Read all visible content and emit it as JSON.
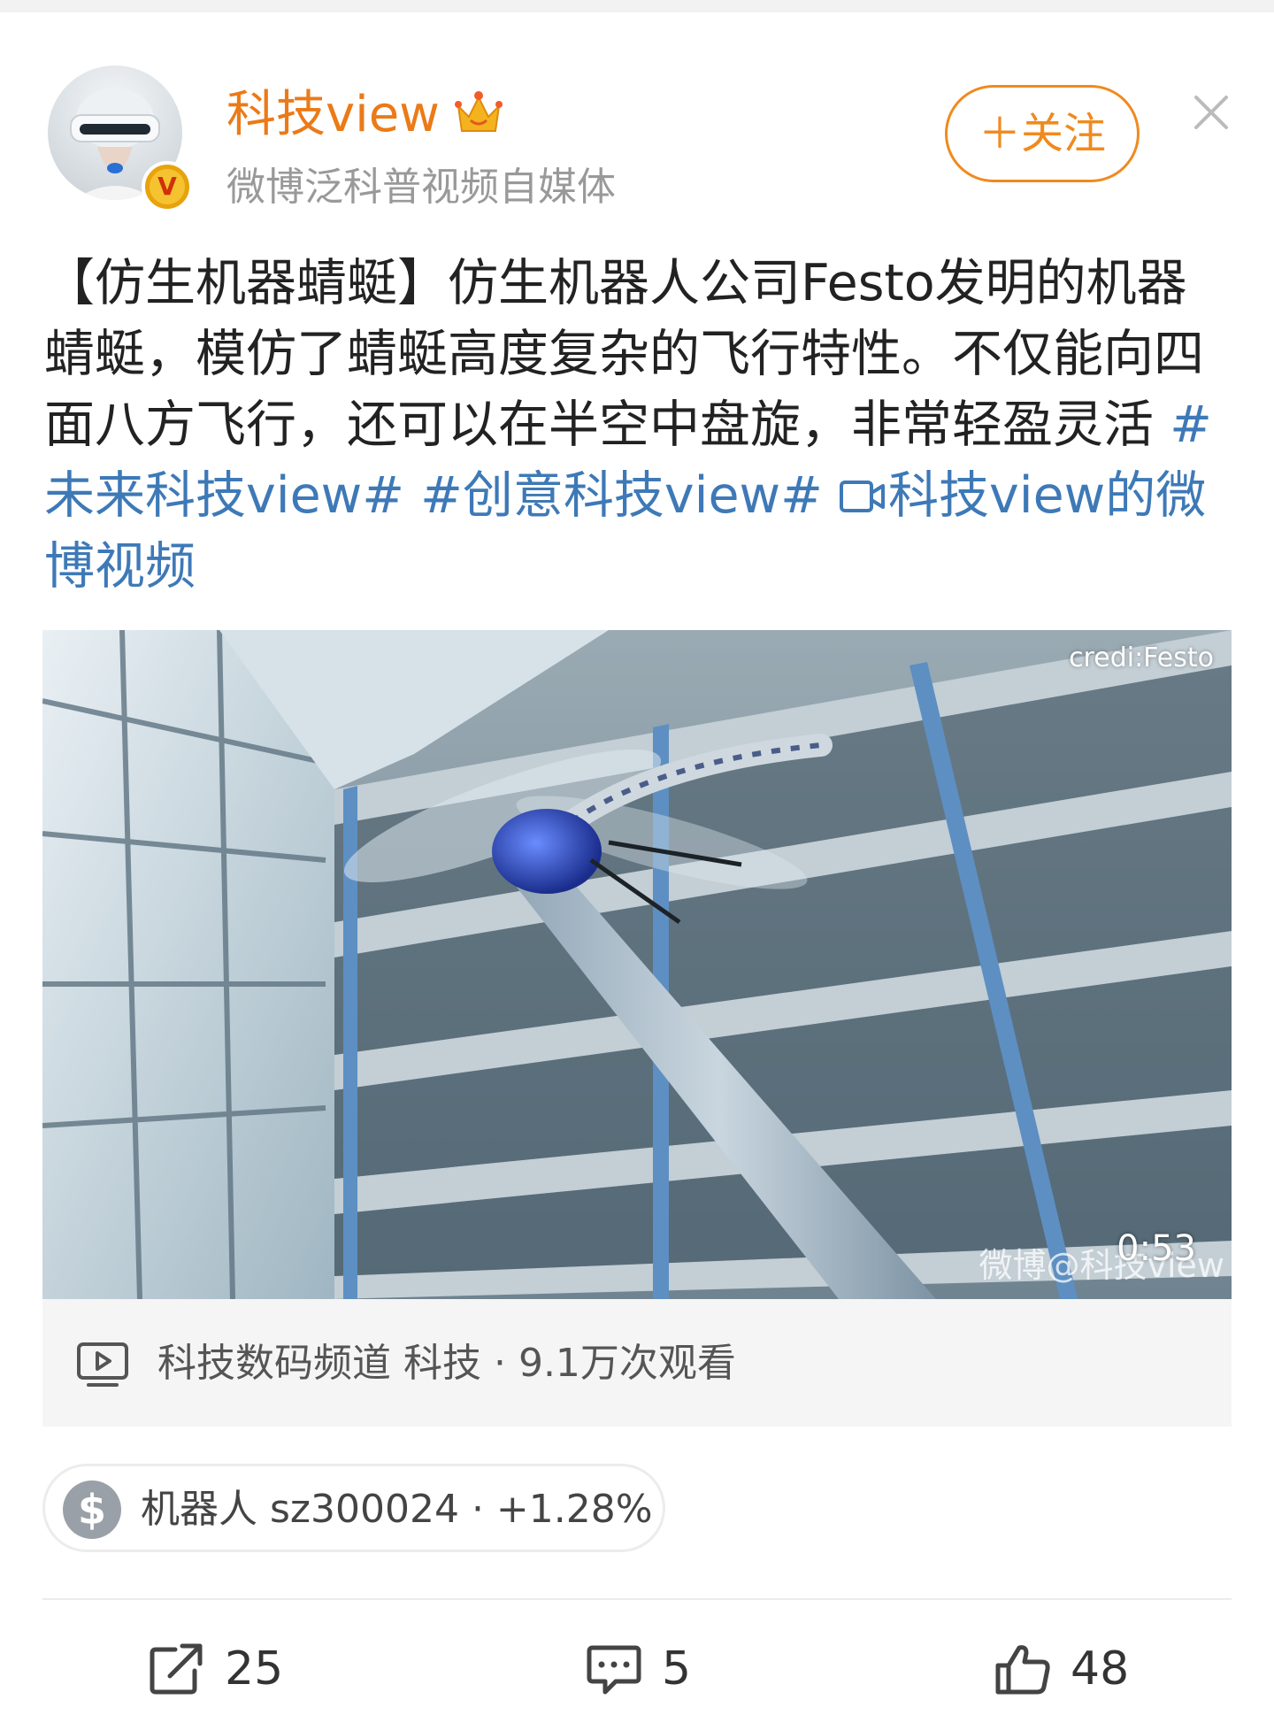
{
  "colors": {
    "accent_orange": "#eb7a17",
    "link_blue": "#3e79b7",
    "muted_gray": "#999999"
  },
  "header": {
    "avatar_icon": "vr-headset-avatar",
    "verified_badge": "V",
    "username": "科技view",
    "crown_icon": "crown-icon",
    "subtitle": "微博泛科普视频自媒体",
    "follow_label": "＋关注",
    "close_icon": "close-icon"
  },
  "post": {
    "text_main": "【仿生机器蜻蜓】仿生机器人公司Festo发明的机器蜻蜓，模仿了蜻蜓高度复杂的飞行特性。不仅能向四面八方飞行，还可以在半空中盘旋，非常轻盈灵活 ",
    "tags": [
      "#未来科技view#",
      "#创意科技view#"
    ],
    "video_link_icon": "video-link-icon",
    "video_link_text": "科技view的微博视频"
  },
  "video": {
    "credit": "credi:Festo",
    "duration": "0:53",
    "watermark": "微博@科技view"
  },
  "video_info": {
    "icon": "play-icon",
    "text": "科技数码频道 科技 · 9.1万次观看"
  },
  "stock": {
    "icon_symbol": "$",
    "text": "机器人 sz300024 · +1.28%"
  },
  "actions": {
    "repost_count": "25",
    "comment_count": "5",
    "like_count": "48"
  }
}
